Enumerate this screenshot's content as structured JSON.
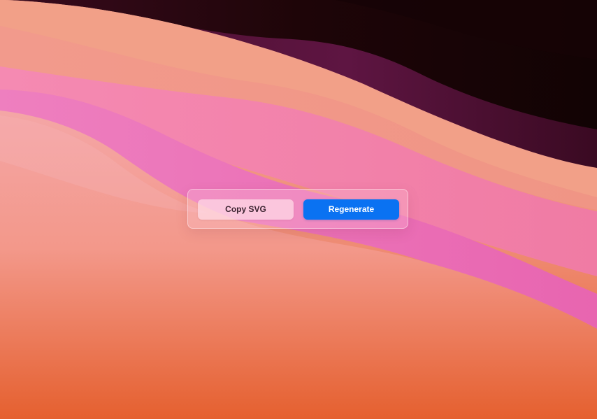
{
  "toolbar": {
    "copy_label": "Copy SVG",
    "regenerate_label": "Regenerate"
  },
  "colors": {
    "accent": "#0a72f2",
    "wallpaper_top": "#1a0508",
    "wallpaper_bottom": "#e8643a"
  }
}
